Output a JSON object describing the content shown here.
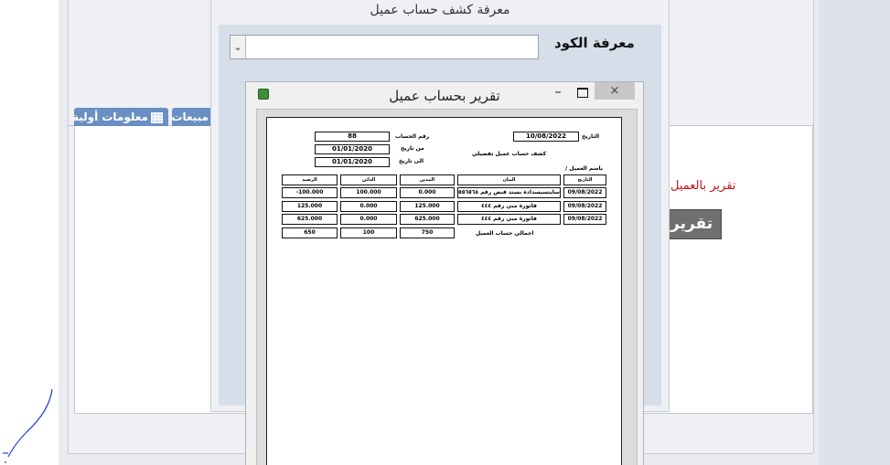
{
  "background": {
    "tabs": [
      {
        "label": "معلومات أولية",
        "icon": "grid-icon"
      },
      {
        "label": "مبيعات"
      }
    ],
    "red_label": "تقرير بالعميل",
    "gray_button": "تقرير"
  },
  "dialog": {
    "title": "معرفة كشف حساب عميل",
    "code_label": "معرفة الكود",
    "dropdown_value": ""
  },
  "report_window": {
    "title": "تقرير بحساب عميل",
    "minimize": "–",
    "close": "×",
    "header": {
      "date_label": "التاريخ",
      "date_value": "10/08/2022",
      "account_label": "رقم الحساب",
      "account_value": "88",
      "from_label": "من تاريخ",
      "from_value": "01/01/2020",
      "to_label": "الى تاريخ",
      "to_value": "01/01/2020",
      "statement_title": "كشف حساب عميل تفصيلي",
      "customer_label": "باسم العميل /"
    },
    "table": {
      "columns": [
        "التاريخ",
        "البيان",
        "المدين",
        "الدائن",
        "الرصيد"
      ],
      "rows": [
        {
          "date": "09/08/2022",
          "desc": "سايتسيسدادة بسند قبض رقم ٥٥٦٥٦٨",
          "debit": "0.000",
          "credit": "100.000",
          "balance": "-100.000"
        },
        {
          "date": "09/08/2022",
          "desc": "فاتورة مبي رقم ٤٤٤",
          "debit": "125.000",
          "credit": "0.000",
          "balance": "125.000"
        },
        {
          "date": "09/08/2022",
          "desc": "فاتورة مبي رقم ٤٤٤",
          "debit": "625.000",
          "credit": "0.000",
          "balance": "625.000"
        }
      ],
      "totals": {
        "label": "اجمالي حساب العميل",
        "debit": "750",
        "credit": "100",
        "balance": "650"
      }
    }
  }
}
